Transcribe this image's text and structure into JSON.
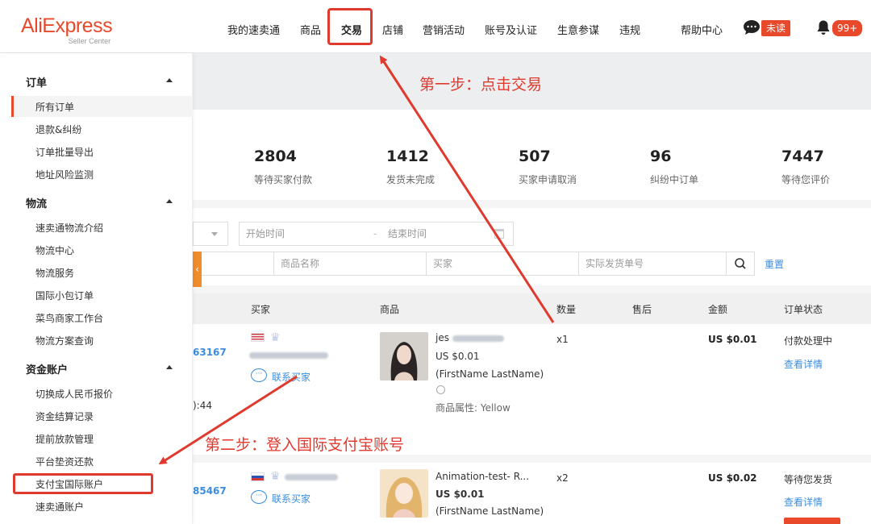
{
  "header": {
    "logo_main": "AliExpress",
    "logo_sub": "Seller Center",
    "nav": [
      "我的速卖通",
      "商品",
      "交易",
      "店铺",
      "营销活动",
      "账号及认证",
      "生意参谋",
      "违规",
      "帮助中心"
    ],
    "unread_badge": "未读",
    "notify_badge": "99+"
  },
  "sidebar": {
    "sections": [
      {
        "title": "订单",
        "items": [
          "所有订单",
          "退款&纠纷",
          "订单批量导出",
          "地址风险监测"
        ]
      },
      {
        "title": "物流",
        "items": [
          "速卖通物流介绍",
          "物流中心",
          "物流服务",
          "国际小包订单",
          "菜鸟商家工作台",
          "物流方案查询"
        ]
      },
      {
        "title": "资金账户",
        "items": [
          "切换成人民币报价",
          "资金结算记录",
          "提前放款管理",
          "平台垫资还款",
          "支付宝国际账户",
          "速卖通账户"
        ]
      }
    ]
  },
  "stats": [
    {
      "num": "2804",
      "label": "等待买家付款"
    },
    {
      "num": "1412",
      "label": "发货未完成"
    },
    {
      "num": "507",
      "label": "买家申请取消"
    },
    {
      "num": "96",
      "label": "纠纷中订单"
    },
    {
      "num": "7447",
      "label": "等待您评价"
    }
  ],
  "filters": {
    "start_time": "开始时间",
    "end_time": "结束时间",
    "product_name": "商品名称",
    "buyer": "买家",
    "tracking_no": "实际发货单号",
    "reset": "重置",
    "collapse_glyph": "‹"
  },
  "table": {
    "headers": [
      "买家",
      "商品",
      "数量",
      "售后",
      "金额",
      "订单状态"
    ],
    "rows": [
      {
        "order_id_tail": "63167",
        "time_tail": "):44",
        "contact": "联系买家",
        "product_line1": "jes",
        "product_line2": "US $0.01",
        "product_line3": "(FirstName LastName)",
        "product_attr": "商品属性: Yellow",
        "qty": "x1",
        "amount": "US $0.01",
        "status": "付款处理中",
        "detail": "查看详情"
      },
      {
        "order_id_tail": "85467",
        "time_tail": "",
        "contact": "联系买家",
        "product_line1": "Animation-test- R...",
        "product_line2": "US $0.01",
        "product_line3": "(FirstName LastName)",
        "product_attr": "",
        "qty": "x2",
        "amount": "US $0.02",
        "status": "等待您发货",
        "detail": "查看详情"
      }
    ]
  },
  "annotations": {
    "step1": "第一步：点击交易",
    "step2": "第二步：登入国际支付宝账号"
  },
  "colors": {
    "brand": "#e8492b",
    "annotation": "#e03a2f",
    "link": "#3a8de0"
  }
}
